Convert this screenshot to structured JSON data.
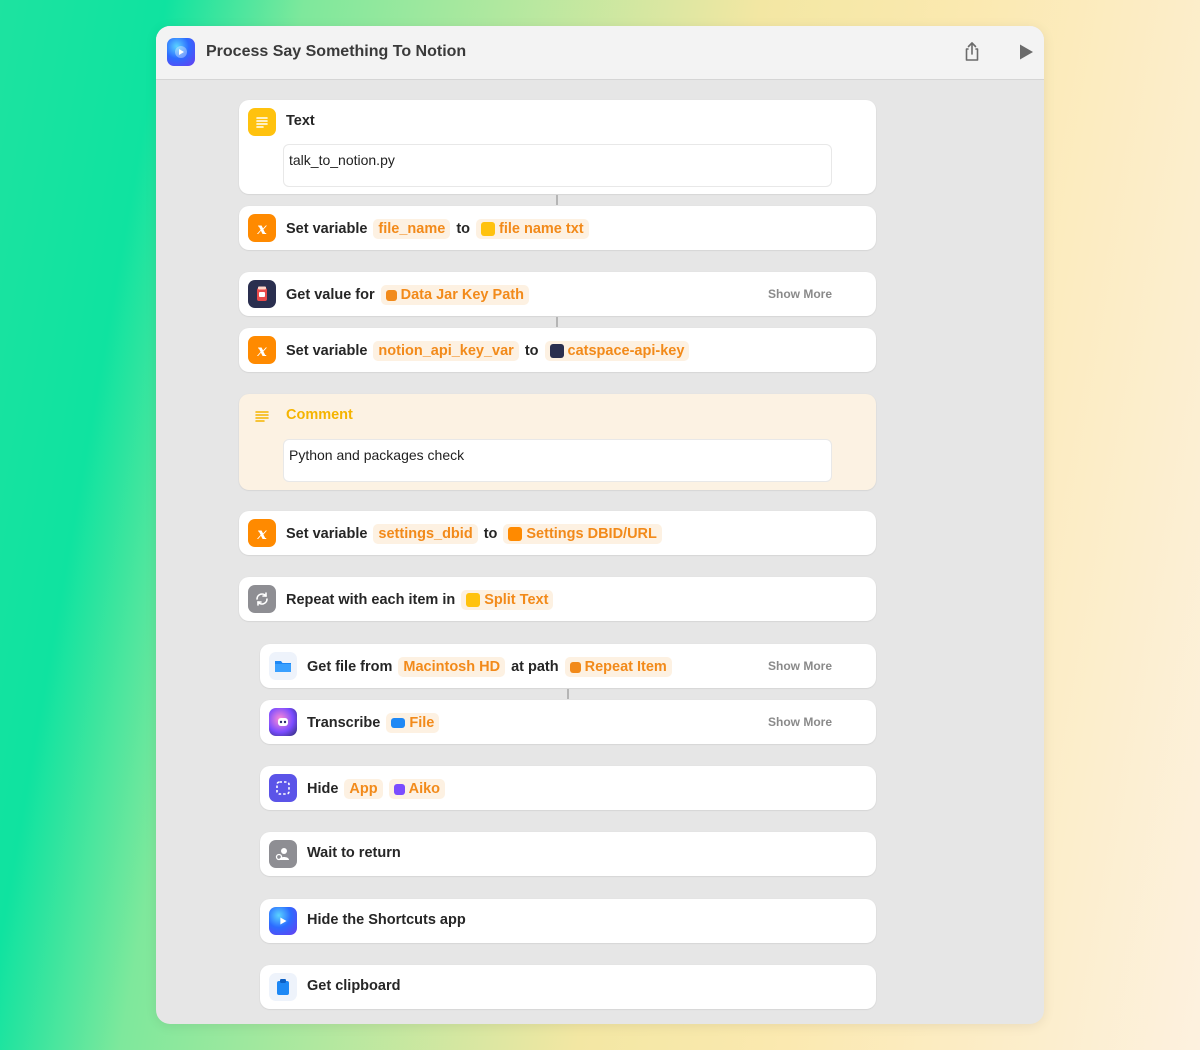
{
  "window": {
    "title": "Process Say Something To Notion"
  },
  "toolbar": {
    "share": "share-icon",
    "run": "play-icon"
  },
  "actions": {
    "text": {
      "title": "Text",
      "value": "talk_to_notion.py"
    },
    "setvar1": {
      "verb": "Set variable",
      "var": "file_name",
      "to": "to",
      "value": "file name txt"
    },
    "getvalue": {
      "verb": "Get value for",
      "param": "Data Jar Key Path",
      "more": "Show More"
    },
    "setvar2": {
      "verb": "Set variable",
      "var": "notion_api_key_var",
      "to": "to",
      "value": "catspace-api-key"
    },
    "comment": {
      "title": "Comment",
      "value": "Python and packages check"
    },
    "setvar3": {
      "verb": "Set variable",
      "var": "settings_dbid",
      "to": "to",
      "value": "Settings DBID/URL"
    },
    "repeat": {
      "verb": "Repeat with each item in",
      "param": "Split Text"
    },
    "getfile": {
      "verb": "Get file from",
      "volume": "Macintosh HD",
      "at": "at path",
      "path": "Repeat Item",
      "more": "Show More"
    },
    "transcribe": {
      "verb": "Transcribe",
      "param": "File",
      "more": "Show More"
    },
    "hide": {
      "verb": "Hide",
      "param": "App",
      "app": "Aiko"
    },
    "wait": {
      "verb": "Wait to return"
    },
    "hideshortcuts": {
      "verb": "Hide the Shortcuts app"
    },
    "clipboard": {
      "verb": "Get clipboard"
    }
  },
  "colors": {
    "accent_orange": "#f28a1a",
    "token_bg": "#fdf1e2",
    "variable_icon": "#ff8a00",
    "text_icon": "#ffc20e",
    "files_blue": "#1e88f5",
    "hide_purple": "#5b54e8",
    "gray_icon": "#8e8e93"
  }
}
